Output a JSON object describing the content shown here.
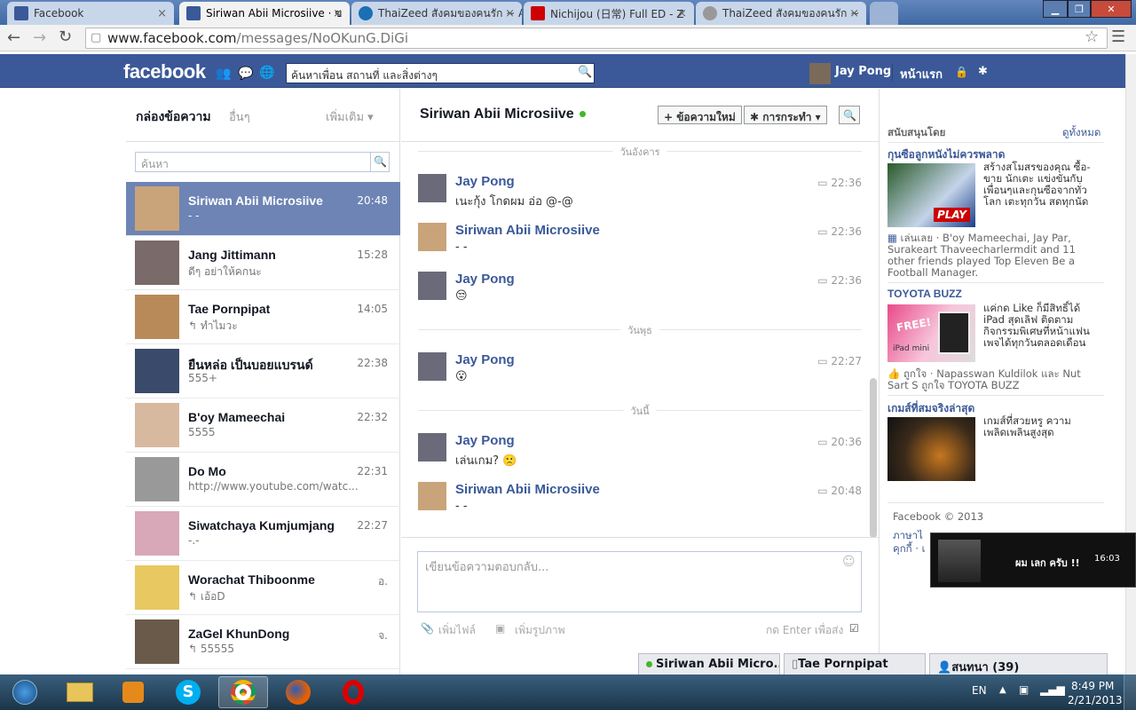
{
  "browser": {
    "tabs": [
      {
        "title": "Facebook",
        "color": "#3b5998"
      },
      {
        "title": "Siriwan Abii Microsiive · ข",
        "color": "#3b5998"
      },
      {
        "title": "ThaiZeed สังคมของคนรัก ~ A",
        "color": "#1a6fb5"
      },
      {
        "title": "Nichijou (日常) Full ED - Z",
        "color": "#cc0000"
      },
      {
        "title": "ThaiZeed สังคมของคนรัก ~",
        "color": "#999999"
      }
    ],
    "url_host": "www.facebook.com",
    "url_path": "/messages/NoOKunG.DiGi"
  },
  "fb": {
    "logo": "facebook",
    "search_placeholder": "ค้นหาเพื่อน สถานที่ และสิ่งต่างๆ",
    "user_name": "Jay Pong",
    "home_label": "หน้าแรก"
  },
  "left": {
    "inbox_label": "กล่องข้อความ",
    "other_label": "อื่นๆ",
    "more_label": "เพิ่มเติม ▾",
    "search_placeholder": "ค้นหา",
    "threads": [
      {
        "name": "Siriwan Abii Microsiive",
        "time": "20:48",
        "snippet": "- -",
        "selected": true
      },
      {
        "name": "Jang Jittimann",
        "time": "15:28",
        "snippet": "ดีๆ อย่าให้คกนะ"
      },
      {
        "name": "Tae Pornpipat",
        "time": "14:05",
        "snippet": "↰ ทำไมวะ"
      },
      {
        "name": "ยืนหล่อ เป็นบอยแบรนด์",
        "time": "22:38",
        "snippet": "555+"
      },
      {
        "name": "B'oy Mameechai",
        "time": "22:32",
        "snippet": "5555"
      },
      {
        "name": "Do Mo",
        "time": "22:31",
        "snippet": "http://www.youtube.com/watc..."
      },
      {
        "name": "Siwatchaya Kumjumjang",
        "time": "22:27",
        "snippet": "-.-"
      },
      {
        "name": "Worachat Thiboonme",
        "time": "อ.",
        "snippet": "↰ เอ้อD"
      },
      {
        "name": "ZaGel KhunDong",
        "time": "จ.",
        "snippet": "↰ 55555"
      }
    ]
  },
  "conv": {
    "title": "Siriwan Abii Microsiive",
    "new_msg_btn": "+ ข้อความใหม่",
    "actions_btn": "✱ การกระทำ ▾",
    "days": [
      "วันอังคาร",
      "วันพุธ",
      "วันนี้"
    ],
    "messages": [
      {
        "name": "Jay Pong",
        "time": "22:36",
        "text": "เนะกุ้ง โกดผม อ่อ @-@"
      },
      {
        "name": "Siriwan Abii Microsiive",
        "time": "22:36",
        "text": "- -"
      },
      {
        "name": "Jay Pong",
        "time": "22:36",
        "text": "😒"
      },
      {
        "name": "Jay Pong",
        "time": "22:27",
        "text": "😮"
      },
      {
        "name": "Jay Pong",
        "time": "20:36",
        "text": "เล่นเกม? 🙁"
      },
      {
        "name": "Siriwan Abii Microsiive",
        "time": "20:48",
        "text": "- -"
      }
    ],
    "compose_placeholder": "เขียนข้อความตอบกลับ...",
    "add_file": "เพิ่มไฟล์",
    "add_photo": "เพิ่มรูปภาพ",
    "enter_send": "กด Enter เพื่อส่ง"
  },
  "right": {
    "sponsored": "สนับสนุนโดย",
    "see_all": "ดูทั้งหมด",
    "ad1_title": "กุนซือลูกหนังไม่ควรพลาด",
    "ad1_text": "สร้างสโมสรของคุณ ซื้อ-ขาย นักเตะ แข่งขันกับเพื่อนๆและกุนซือจากทั่วโลก เตะทุกวัน สดทุกนัด",
    "ad1_play": "PLAY",
    "ad1_social": "เล่นเลย · B'oy Mameechai, Jay Par, Surakeart Thaveecharlermdit and 11 other friends played Top Eleven Be a Football Manager.",
    "ad2_title": "TOYOTA BUZZ",
    "ad2_text": "แค่กด Like ก็มีสิทธิ์ได้ iPad สุดเลิฟ ติดตามกิจกรรมพิเศษที่หน้าแฟนเพจได้ทุกวันตลอดเดือน",
    "ad2_free": "FREE!",
    "ad2_ipad": "iPad mini",
    "ad2_social": "ถูกใจ · Napasswan Kuldilok และ Nut Sart S ถูกใจ TOYOTA BUZZ",
    "ad3_title": "เกมส์ที่สมจริงล่าสุด",
    "ad3_text": "เกมส์ที่สวยหรู ความเพลิดเพลินสูงสุด",
    "footer": "Facebook © 2013",
    "footer2": "ภาษาไ",
    "footer3": "คุกกี้ · เ"
  },
  "chat": {
    "tab1": "Siriwan Abii Micro...",
    "tab2": "Tae Pornpipat",
    "tab3": "สนทนา (39)"
  },
  "notif": {
    "text": "ผม เลก ครับ !!",
    "time": "16:03"
  },
  "taskbar": {
    "lang": "EN",
    "time": "8:49 PM",
    "date": "2/21/2013"
  }
}
